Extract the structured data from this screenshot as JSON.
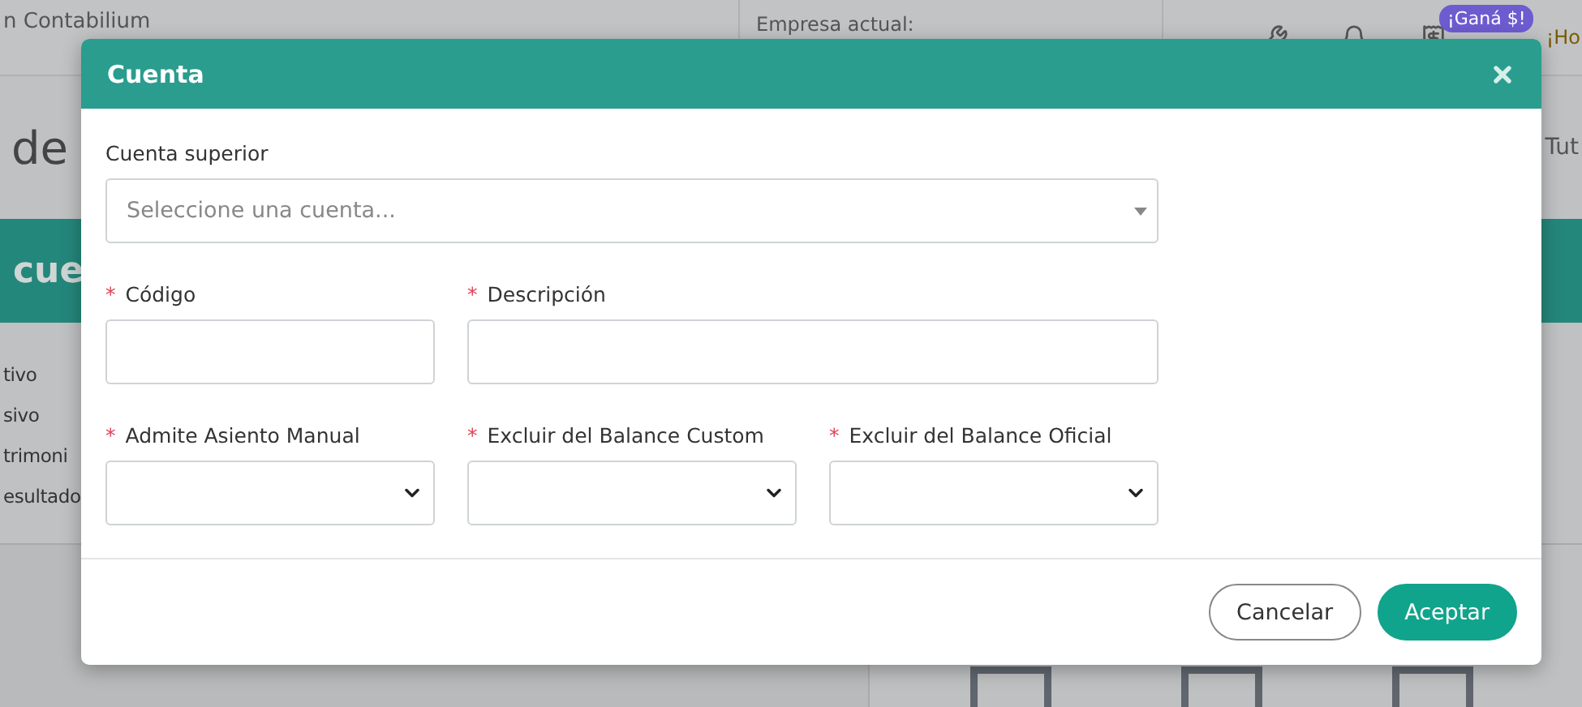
{
  "background": {
    "brand": "n Contabilium",
    "company_label": "Empresa actual:",
    "promo_badge": "¡Ganá $!",
    "greeting": "¡Ho",
    "page_title": "de",
    "tutorial_link": "Tut",
    "section_title": "cue",
    "account_types": [
      "tivo",
      "sivo",
      "trimoni",
      "esultado"
    ]
  },
  "dialog": {
    "title": "Cuenta",
    "rows": [
      [
        {
          "kind": "combobox",
          "label": "Cuenta superior",
          "placeholder": "Seleccione una cuenta..."
        }
      ],
      [
        {
          "kind": "text",
          "mark": "*",
          "label": "Código"
        },
        {
          "kind": "text",
          "mark": "*",
          "label": "Descripción"
        }
      ],
      [
        {
          "kind": "select",
          "mark": "*",
          "label": "Admite Asiento Manual"
        },
        {
          "kind": "select",
          "mark": "*",
          "label": "Excluir del Balance Custom"
        },
        {
          "kind": "select",
          "mark": "*",
          "label": "Excluir del Balance Oficial"
        }
      ]
    ],
    "buttons": [
      {
        "label": "Cancelar",
        "kind": "secondary"
      },
      {
        "label": "Aceptar",
        "kind": "primary"
      }
    ]
  }
}
